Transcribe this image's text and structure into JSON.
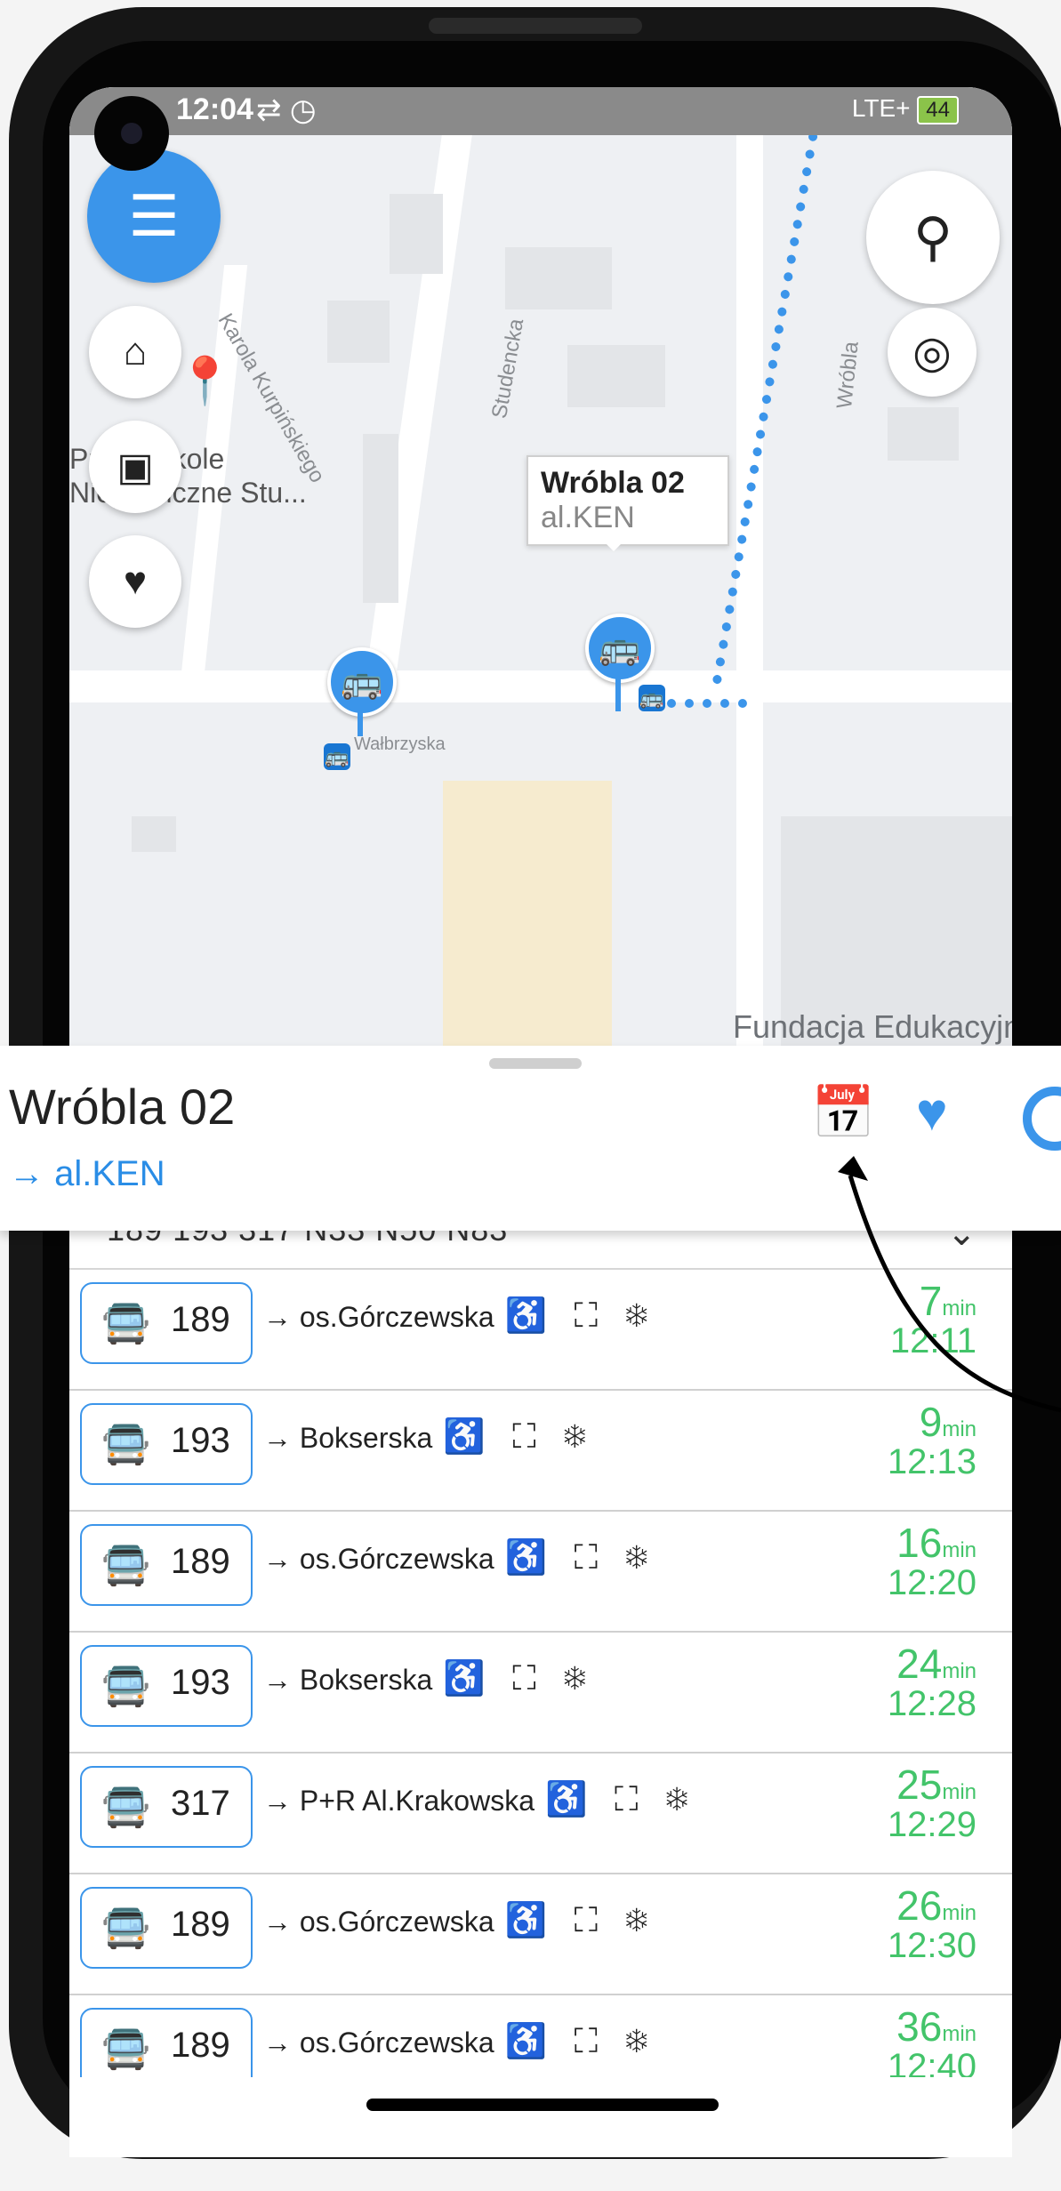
{
  "status": {
    "time": "12:04",
    "icons": "⇄ ◷",
    "signal": "LTE+",
    "battery": "44"
  },
  "map": {
    "streets": [
      "Karola Kurpińskiego",
      "Studencka",
      "Wróbla",
      "Wałbrzyska"
    ],
    "poi": [
      "Przedszkole",
      "Niepubliczne Stu..."
    ],
    "place_label": "Fundacja Edukacyjna",
    "callout_title": "Wróbla 02",
    "callout_subtitle": "al.KEN"
  },
  "buttons": {
    "menu": "☰",
    "search": "⚲",
    "locate": "◎",
    "home": "⌂",
    "work": "▣",
    "favorites": "♥"
  },
  "stop": {
    "name": "Wróbla 02",
    "direction": "→ al.KEN"
  },
  "lines_summary": "189 193 317 N33 N50 N83",
  "departures": [
    {
      "line": "189",
      "destination": "→ os.Górczewska",
      "minutes": "7",
      "unit": "min",
      "time": "12:11"
    },
    {
      "line": "193",
      "destination": "→ Bokserska",
      "minutes": "9",
      "unit": "min",
      "time": "12:13"
    },
    {
      "line": "189",
      "destination": "→ os.Górczewska",
      "minutes": "16",
      "unit": "min",
      "time": "12:20"
    },
    {
      "line": "193",
      "destination": "→ Bokserska",
      "minutes": "24",
      "unit": "min",
      "time": "12:28"
    },
    {
      "line": "317",
      "destination": "→ P+R Al.Krakowska",
      "minutes": "25",
      "unit": "min",
      "time": "12:29"
    },
    {
      "line": "189",
      "destination": "→ os.Górczewska",
      "minutes": "26",
      "unit": "min",
      "time": "12:30"
    },
    {
      "line": "189",
      "destination": "→ os.Górczewska",
      "minutes": "36",
      "unit": "min",
      "time": "12:40"
    }
  ],
  "feature_icons": "♿ ⛶ ❄",
  "colors": {
    "accent": "#3b95ea",
    "time_green": "#43c46a"
  }
}
